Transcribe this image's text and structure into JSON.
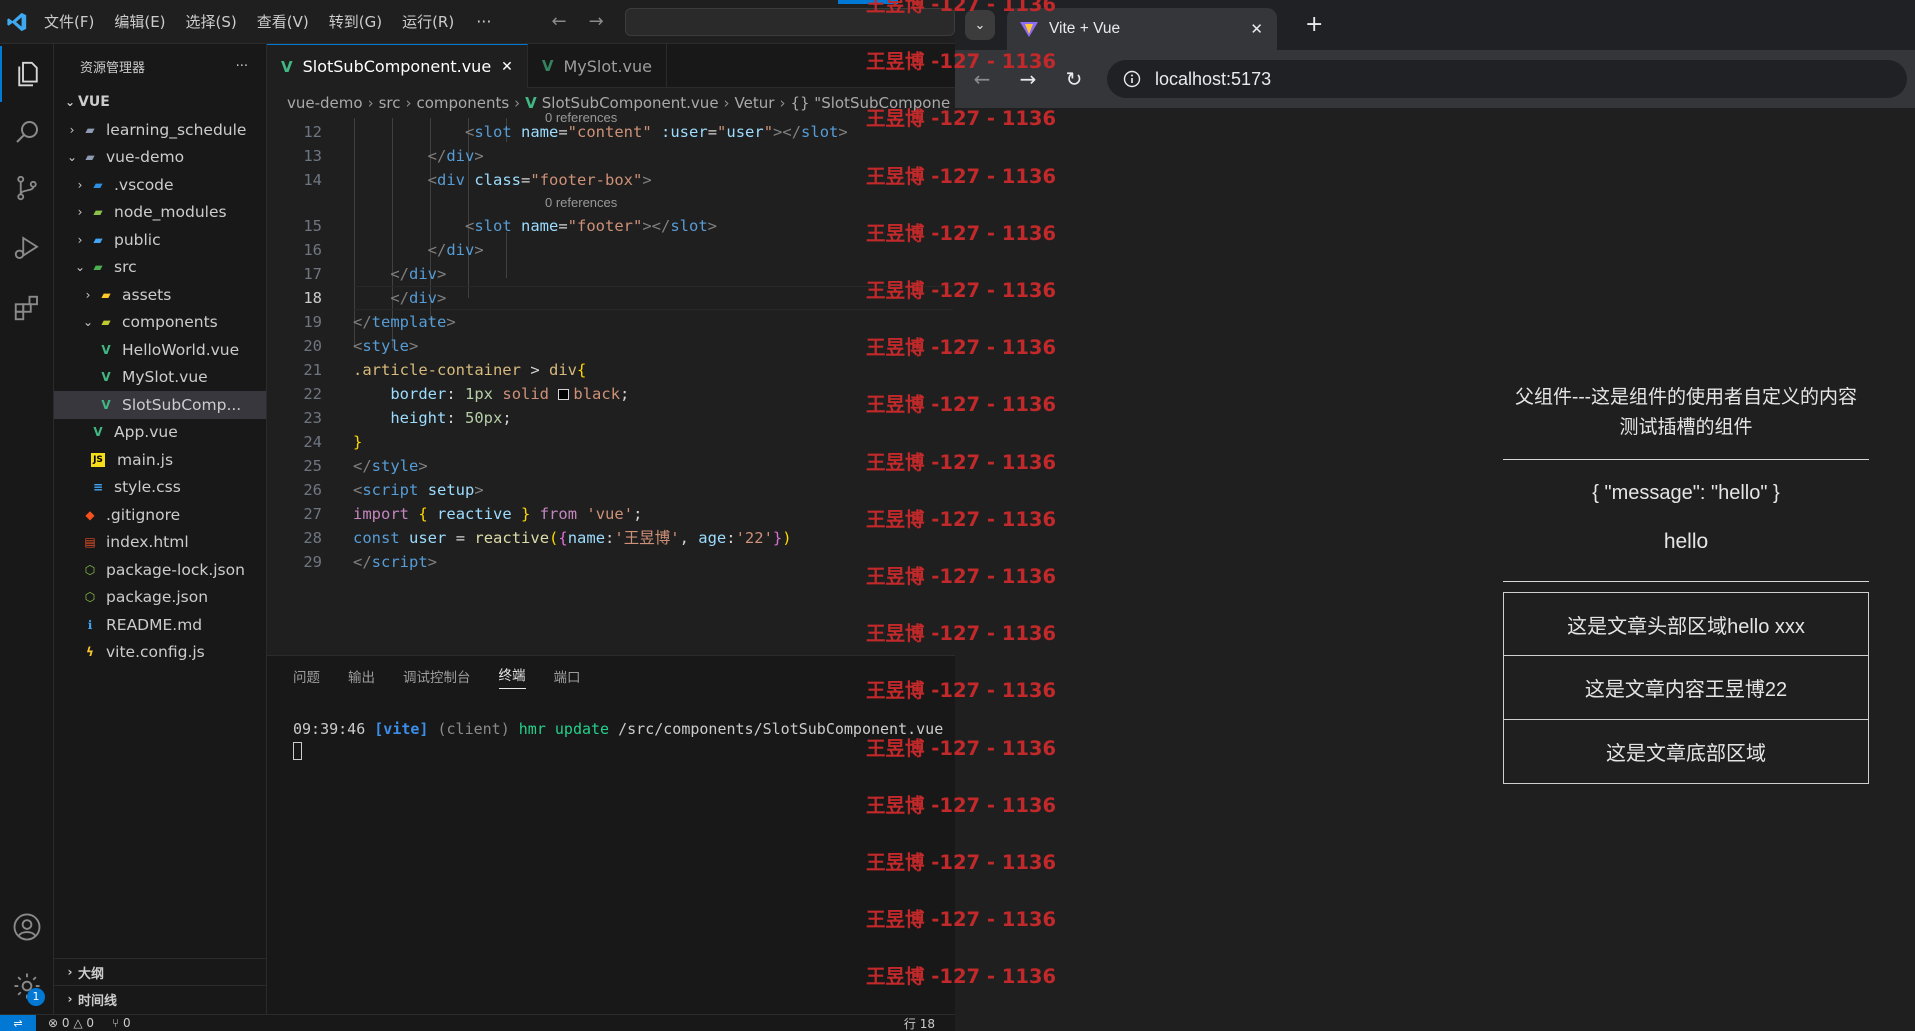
{
  "vscode": {
    "menu": [
      "文件(F)",
      "编辑(E)",
      "选择(S)",
      "查看(V)",
      "转到(G)",
      "运行(R)"
    ],
    "menu_more": "···",
    "sidebar": {
      "title": "资源管理器",
      "more": "···",
      "root": "VUE",
      "tree": [
        {
          "label": "learning_schedule",
          "icon": "folder-icon",
          "depth": 1,
          "chev": "›"
        },
        {
          "label": "vue-demo",
          "icon": "folder-open-icon",
          "depth": 1,
          "chev": "⌄"
        },
        {
          "label": ".vscode",
          "icon": "vscode-folder-icon",
          "depth": 2,
          "chev": "›"
        },
        {
          "label": "node_modules",
          "icon": "node-folder-icon",
          "depth": 2,
          "chev": "›"
        },
        {
          "label": "public",
          "icon": "public-folder-icon",
          "depth": 2,
          "chev": "›"
        },
        {
          "label": "src",
          "icon": "src-folder-icon",
          "depth": 2,
          "chev": "⌄"
        },
        {
          "label": "assets",
          "icon": "assets-folder-icon",
          "depth": 3,
          "chev": "›"
        },
        {
          "label": "components",
          "icon": "components-folder-icon",
          "depth": 3,
          "chev": "⌄"
        },
        {
          "label": "HelloWorld.vue",
          "icon": "vue-file-icon",
          "depth": 4,
          "chev": ""
        },
        {
          "label": "MySlot.vue",
          "icon": "vue-file-icon",
          "depth": 4,
          "chev": ""
        },
        {
          "label": "SlotSubComp...",
          "icon": "vue-file-icon",
          "depth": 4,
          "chev": "",
          "selected": true
        },
        {
          "label": "App.vue",
          "icon": "vue-file-icon",
          "depth": 3,
          "chev": ""
        },
        {
          "label": "main.js",
          "icon": "js-file-icon",
          "depth": 3,
          "chev": ""
        },
        {
          "label": "style.css",
          "icon": "css-file-icon",
          "depth": 3,
          "chev": ""
        },
        {
          "label": ".gitignore",
          "icon": "git-file-icon",
          "depth": 2,
          "chev": ""
        },
        {
          "label": "index.html",
          "icon": "html-file-icon",
          "depth": 2,
          "chev": ""
        },
        {
          "label": "package-lock.json",
          "icon": "node-file-icon",
          "depth": 2,
          "chev": ""
        },
        {
          "label": "package.json",
          "icon": "node-file-icon",
          "depth": 2,
          "chev": ""
        },
        {
          "label": "README.md",
          "icon": "info-file-icon",
          "depth": 2,
          "chev": ""
        },
        {
          "label": "vite.config.js",
          "icon": "vite-file-icon",
          "depth": 2,
          "chev": ""
        }
      ],
      "outline": "大纲",
      "timeline": "时间线"
    },
    "tabs": [
      {
        "label": "SlotSubComponent.vue",
        "active": true,
        "close": "✕"
      },
      {
        "label": "MySlot.vue",
        "active": false
      }
    ],
    "breadcrumb": [
      "vue-demo",
      "src",
      "components",
      "SlotSubComponent.vue",
      "Vetur",
      "{} \"SlotSubCompone"
    ],
    "codelens_top": "0 references",
    "codelens_mid": "0 references",
    "panel_tabs": [
      "问题",
      "输出",
      "调试控制台",
      "终端",
      "端口"
    ],
    "terminal": {
      "time": "09:39:46",
      "tag": "[vite]",
      "client": "(client)",
      "hmr": "hmr update",
      "path": "/src/components/SlotSubComponent.vue",
      "tail": "("
    },
    "status": {
      "errors": "⊗ 0 △ 0",
      "ports": "⑂ 0",
      "position": "行 18"
    }
  },
  "watermark": "王昱博 -127 - 1136",
  "browser": {
    "tab_title": "Vite + Vue",
    "tab_close": "✕",
    "new_tab": "+",
    "url": "localhost:5173",
    "app": {
      "line1": "父组件---这是组件的使用者自定义的内容",
      "line2": "测试插槽的组件",
      "json": "{ \"message\": \"hello\" }",
      "hello": "hello",
      "header": "这是文章头部区域hello xxx",
      "content": "这是文章内容王昱博22",
      "footer": "这是文章底部区域"
    }
  },
  "colors": {
    "vscode_bg": "#1f1f1f",
    "accent": "#0078d4",
    "watermark": "#c3292a",
    "vue_green": "#41b883"
  }
}
